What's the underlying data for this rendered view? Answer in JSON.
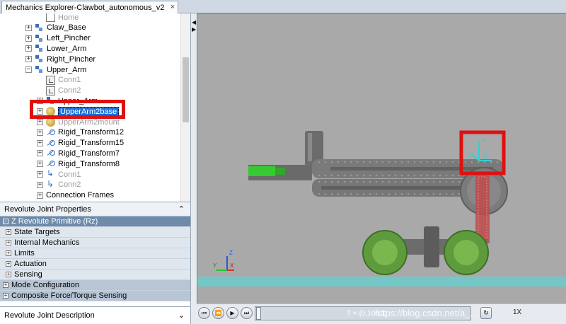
{
  "tab": {
    "title": "Mechanics Explorer-Clawbot_autonomous_v2",
    "close_glyph": "×"
  },
  "tree": {
    "items": [
      {
        "label": "Home",
        "icon": "doc-icon",
        "expander": "",
        "indent": 2,
        "grey": true
      },
      {
        "label": "Claw_Base",
        "icon": "body-icon",
        "expander": "+",
        "indent": 1,
        "grey": false
      },
      {
        "label": "Left_Pincher",
        "icon": "body-icon",
        "expander": "+",
        "indent": 1,
        "grey": false
      },
      {
        "label": "Lower_Arm",
        "icon": "body-icon",
        "expander": "+",
        "indent": 1,
        "grey": false
      },
      {
        "label": "Right_Pincher",
        "icon": "body-icon",
        "expander": "+",
        "indent": 1,
        "grey": false
      },
      {
        "label": "Upper_Arm",
        "icon": "body-icon",
        "expander": "−",
        "indent": 1,
        "grey": false
      },
      {
        "label": "Conn1",
        "icon": "connector-icon",
        "expander": "",
        "indent": 2,
        "grey": true
      },
      {
        "label": "Conn2",
        "icon": "connector-icon",
        "expander": "",
        "indent": 2,
        "grey": true
      },
      {
        "label": "Upper_Arm",
        "icon": "body-icon",
        "expander": "+",
        "indent": 2,
        "grey": false
      },
      {
        "label": "UpperArm2base",
        "icon": "revolute-joint-icon",
        "expander": "+",
        "indent": 2,
        "grey": false,
        "selected": true
      },
      {
        "label": "UpperArm2mount",
        "icon": "revolute-joint-icon",
        "expander": "+",
        "indent": 2,
        "grey": true
      },
      {
        "label": "Rigid_Transform12",
        "icon": "rigid-transform-icon",
        "expander": "+",
        "indent": 2,
        "grey": false
      },
      {
        "label": "Rigid_Transform15",
        "icon": "rigid-transform-icon",
        "expander": "+",
        "indent": 2,
        "grey": false
      },
      {
        "label": "Rigid_Transform7",
        "icon": "rigid-transform-icon",
        "expander": "+",
        "indent": 2,
        "grey": false
      },
      {
        "label": "Rigid_Transform8",
        "icon": "rigid-transform-icon",
        "expander": "+",
        "indent": 2,
        "grey": false
      },
      {
        "label": "Conn1",
        "icon": "frame-icon",
        "expander": "+",
        "indent": 2,
        "grey": true
      },
      {
        "label": "Conn2",
        "icon": "frame-icon",
        "expander": "+",
        "indent": 2,
        "grey": true
      },
      {
        "label": "Connection Frames",
        "icon": "",
        "expander": "+",
        "indent": 2,
        "grey": false
      }
    ]
  },
  "properties": {
    "title": "Revolute Joint Properties",
    "collapse_glyph": "⌃",
    "primitive": "Z Revolute Primitive (Rz)",
    "groups": [
      "State Targets",
      "Internal Mechanics",
      "Limits",
      "Actuation",
      "Sensing"
    ],
    "sections": [
      "Mode Configuration",
      "Composite Force/Torque Sensing"
    ]
  },
  "description": {
    "title": "Revolute Joint Description",
    "expand_glyph": "⌄"
  },
  "viewport": {
    "triad_labels": {
      "x": "X",
      "y": "Y",
      "z": "Z"
    },
    "small_triad_labels": {
      "z": "Z",
      "y": "Y",
      "x": "X"
    },
    "colors": {
      "background": "#a9a9a9",
      "ground": "#73c7c7",
      "arm": "#7a7a7a",
      "wheel": "#5e9b3c",
      "claw_accent": "#37c932",
      "highlight_box": "#e01010",
      "frame_triad": "#30d0d8"
    }
  },
  "playback": {
    "time_text": "T = {0,106.1}",
    "watermark": "https://blog.csdn.net/a_...",
    "speed": "1X",
    "buttons": [
      "⏮",
      "⏪",
      "▶",
      "⏭"
    ]
  }
}
